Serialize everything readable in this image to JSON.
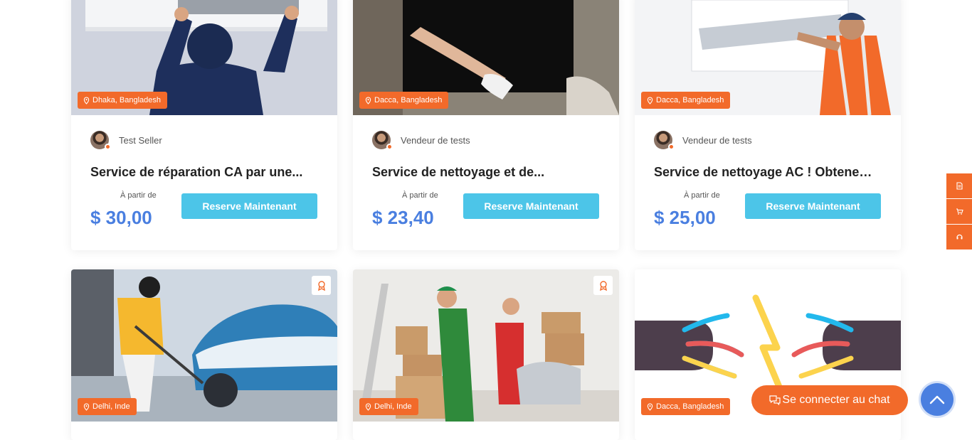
{
  "cards": [
    {
      "location": "Dhaka, Bangladesh",
      "seller": "Test Seller",
      "title": "Service de réparation CA par une...",
      "from_label": "À partir de",
      "price": "$ 30,00",
      "button": "Reserve Maintenant"
    },
    {
      "location": "Dacca, Bangladesh",
      "seller": "Vendeur de tests",
      "title": "Service de nettoyage et de...",
      "from_label": "À partir de",
      "price": "$ 23,40",
      "button": "Reserve Maintenant"
    },
    {
      "location": "Dacca, Bangladesh",
      "seller": "Vendeur de tests",
      "title": "Service de nettoyage AC ! Obtenez...",
      "from_label": "À partir de",
      "price": "$ 25,00",
      "button": "Reserve Maintenant"
    },
    {
      "location": "Delhi, Inde"
    },
    {
      "location": "Delhi, Inde"
    },
    {
      "location": "Dacca, Bangladesh"
    }
  ],
  "side_tools": [
    "document-icon",
    "cart-icon",
    "support-icon"
  ],
  "chat": {
    "label": "Se connecter au chat"
  },
  "colors": {
    "accent": "#f26a2a",
    "button": "#4cc5e8",
    "price": "#4a7fe0"
  }
}
